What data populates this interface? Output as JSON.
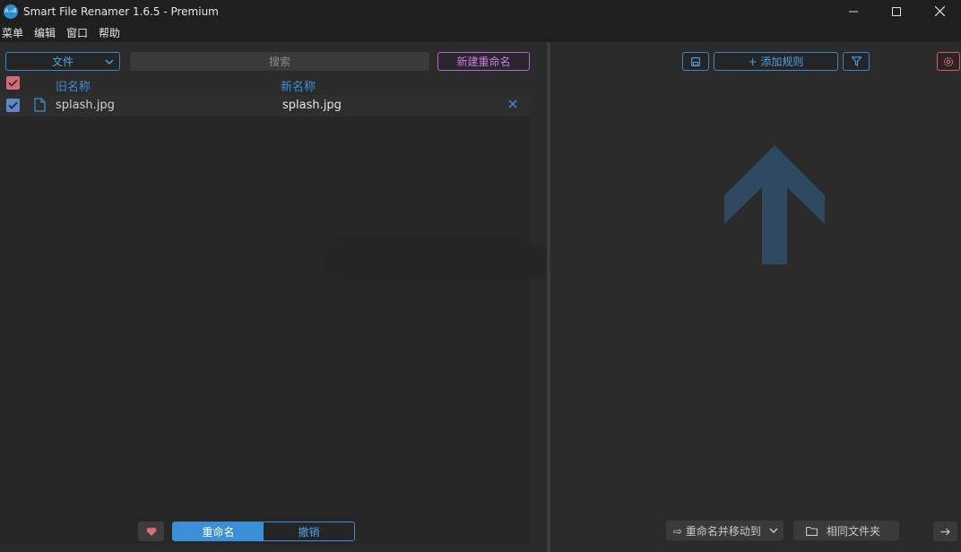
{
  "window": {
    "title": "Smart File Renamer 1.6.5 - Premium",
    "app_icon_text": "A→B"
  },
  "menu": [
    "菜单",
    "编辑",
    "窗口",
    "帮助"
  ],
  "left": {
    "type_select": "文件",
    "search_placeholder": "搜索",
    "new_rename_label": "新建重命名",
    "columns": {
      "old": "旧名称",
      "new": "新名称"
    },
    "files": [
      {
        "old_name": "splash.jpg",
        "new_name": "splash.jpg",
        "checked": true
      }
    ],
    "rename_label": "重命名",
    "undo_label": "撤销"
  },
  "right": {
    "add_rule_label": "+ 添加规则",
    "move_select_label": "⇨ 重命名并移动到",
    "same_folder_label": "相同文件夹"
  },
  "colors": {
    "accent_blue": "#3a8fd6",
    "accent_purple": "#c47fd9",
    "accent_red": "#d45c6a",
    "arrow": "#2f4a60"
  }
}
